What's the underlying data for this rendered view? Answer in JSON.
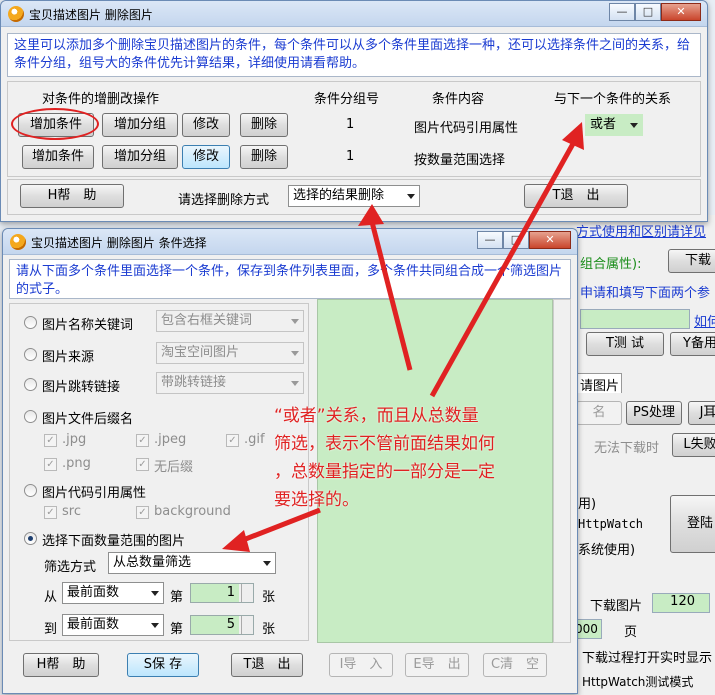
{
  "background": {
    "items": [
      "方式使用和区别请详见",
      "组合属性):",
      "下载",
      "申请和填写下面两个参",
      "如何",
      "T测 试",
      "Y备用",
      "请图片",
      "名",
      "PS处理",
      "J耳",
      "无法下载时",
      "L失败",
      "用)",
      "HttpWatch",
      "登陆",
      "系统使用)",
      "下载图片",
      "120",
      "000",
      "页",
      "下载过程打开实时显示",
      "HttpWatch测试模式"
    ]
  },
  "main_window": {
    "title": "宝贝描述图片 删除图片",
    "controls": {
      "minimize": "—",
      "maximize": "□",
      "close": "✕"
    },
    "info": "这里可以添加多个删除宝贝描述图片的条件，每个条件可以从多个条件里面选择一种，还可以选择条件之间的关系，给条件分组，组号大的条件优先计算结果，详细使用请看帮助。",
    "headers": {
      "ops": "对条件的增删改操作",
      "group": "条件分组号",
      "content": "条件内容",
      "relation": "与下一个条件的关系"
    },
    "rows": [
      {
        "add": "增加条件",
        "add_group": "增加分组",
        "modify": "修改",
        "delete": "删除",
        "group": "1",
        "content": "图片代码引用属性",
        "relation": "或者"
      },
      {
        "add": "增加条件",
        "add_group": "增加分组",
        "modify": "修改",
        "delete": "删除",
        "group": "1",
        "content": "按数量范围选择",
        "relation": ""
      }
    ],
    "help": "H帮　助",
    "delete_mode_label": "请选择删除方式",
    "delete_mode": "选择的结果删除",
    "exit": "T退　出"
  },
  "dialog": {
    "title": "宝贝描述图片 删除图片 条件选择",
    "controls": {
      "minimize": "—",
      "maximize": "□",
      "close": "✕"
    },
    "info": "请从下面多个条件里面选择一个条件，保存到条件列表里面，多个条件共同组合成一个筛选图片的式子。",
    "opt_keyword": "图片名称关键词",
    "opt_keyword_combo": "包含右框关键词",
    "opt_source": "图片来源",
    "opt_source_combo": "淘宝空间图片",
    "opt_link": "图片跳转链接",
    "opt_link_combo": "带跳转链接",
    "opt_suffix": "图片文件后缀名",
    "suffixes": [
      ".jpg",
      ".jpeg",
      ".gif",
      ".png",
      "无后缀"
    ],
    "opt_code": "图片代码引用属性",
    "attrs": [
      "src",
      "background"
    ],
    "opt_range": "选择下面数量范围的图片",
    "filter_label": "筛选方式",
    "filter_value": "从总数量筛选",
    "from_label": "从",
    "from_combo": "最前面数",
    "from_di": "第",
    "from_val": "1",
    "from_unit": "张",
    "to_label": "到",
    "to_combo": "最前面数",
    "to_di": "第",
    "to_val": "5",
    "to_unit": "张",
    "btn_help": "H帮　助",
    "btn_save": "S保 存",
    "btn_exit": "T退　出",
    "btn_import": "I导　入",
    "btn_export": "E导　出",
    "btn_clear": "C清　空"
  },
  "annotation": {
    "lines": [
      "“或者”关系，而且从总数量",
      "筛选，表示不管前面结果如何",
      "，总数量指定的一部分是一定",
      "要选择的。"
    ]
  },
  "colors": {
    "accent_red": "#e02222",
    "info_blue": "#1a3bd1",
    "green_field": "#c8ecc4"
  }
}
